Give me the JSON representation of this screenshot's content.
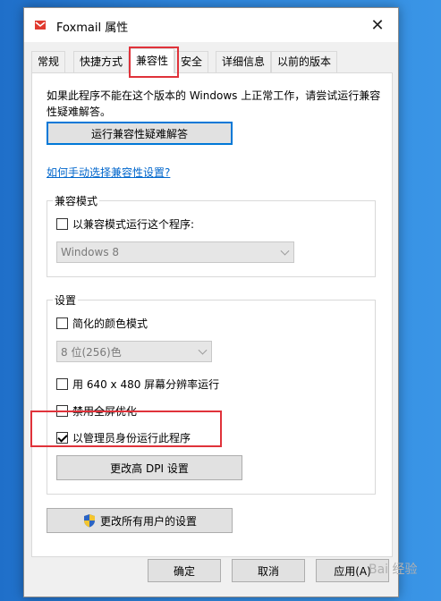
{
  "window": {
    "title": "Foxmail 属性",
    "close_glyph": "✕"
  },
  "tabs": [
    {
      "label": "常规"
    },
    {
      "label": "快捷方式"
    },
    {
      "label": "兼容性"
    },
    {
      "label": "安全"
    },
    {
      "label": "详细信息"
    },
    {
      "label": "以前的版本"
    }
  ],
  "compat": {
    "description": "如果此程序不能在这个版本的 Windows 上正常工作，请尝试运行兼容性疑难解答。",
    "troubleshooter_button": "运行兼容性疑难解答",
    "manual_link": "如何手动选择兼容性设置?"
  },
  "compat_mode": {
    "group_title": "兼容模式",
    "checkbox_label": "以兼容模式运行这个程序:",
    "checkbox_checked": false,
    "os_select_value": "Windows 8"
  },
  "settings": {
    "group_title": "设置",
    "reduced_color_label": "简化的颜色模式",
    "reduced_color_checked": false,
    "color_select_value": "8 位(256)色",
    "resolution_label": "用 640 x 480 屏幕分辨率运行",
    "resolution_checked": false,
    "fullscreen_opt_label": "禁用全屏优化",
    "fullscreen_opt_checked": false,
    "run_as_admin_label": "以管理员身份运行此程序",
    "run_as_admin_checked": true,
    "dpi_button": "更改高 DPI 设置"
  },
  "all_users_button": "更改所有用户的设置",
  "footer": {
    "ok": "确定",
    "cancel": "取消",
    "apply": "应用(A)"
  },
  "watermark": "Bai 经验",
  "colors": {
    "highlight_box": "#e0323a",
    "link": "#0066cc",
    "primary_border": "#0078d7"
  }
}
